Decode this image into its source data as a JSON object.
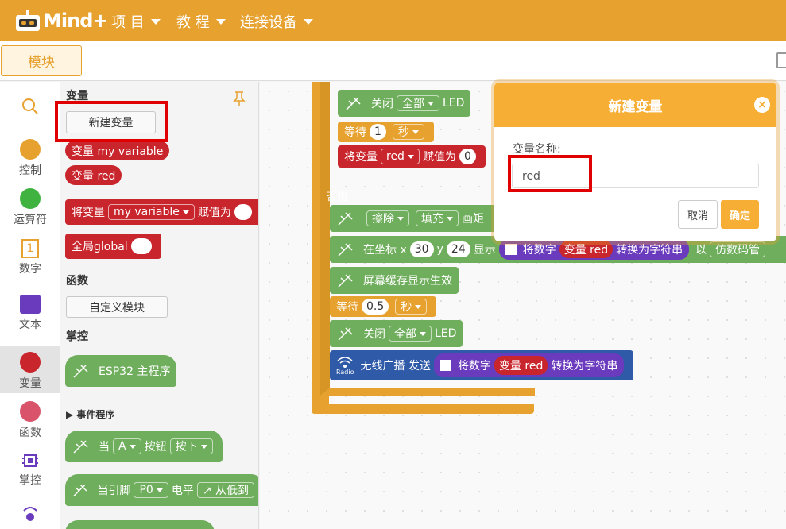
{
  "header": {
    "logo": "Mind+",
    "menus": [
      "项 目",
      "教 程",
      "连接设备"
    ]
  },
  "subbar": {
    "module_tab": "模块"
  },
  "categories": [
    {
      "label": "",
      "icon": "search-icon"
    },
    {
      "label": "控制",
      "color": "#e7a12f"
    },
    {
      "label": "运算符",
      "color": "#3fb23f"
    },
    {
      "label": "数字",
      "icon": "number-icon",
      "glyph": "1"
    },
    {
      "label": "文本",
      "icon": "text-icon"
    },
    {
      "label": "变量",
      "color": "#c8252c"
    },
    {
      "label": "函数",
      "color": "#d9536a"
    },
    {
      "label": "掌控",
      "icon": "chip-icon"
    },
    {
      "label": "",
      "icon": "radio-icon"
    }
  ],
  "flyout": {
    "section_variable": "变量",
    "new_variable_button": "新建变量",
    "var_my_variable": "变量 my variable",
    "var_red": "变量 red",
    "set_var_prefix": "将变量",
    "set_var_name": "my variable",
    "set_var_suffix": "赋值为",
    "global_label": "全局global",
    "section_function": "函数",
    "custom_block_button": "自定义模块",
    "section_controller": "掌控",
    "esp32_main": "ESP32 主程序",
    "event_section": "▶ 事件程序",
    "when_prefix": "当",
    "when_btn": "A",
    "when_key": "按钮",
    "when_press": "按下",
    "pin_prefix": "当引脚",
    "pin_name": "P0",
    "pin_level": "电平",
    "pin_edge": "↗ 从低到"
  },
  "workspace": {
    "off_label": "关闭",
    "all_label": "全部",
    "led_label": "LED",
    "wait_label": "等待",
    "wait_1": "1",
    "sec_label": "秒",
    "set_var_prefix": "将变量",
    "set_var_name": "red",
    "set_var_suffix": "赋值为",
    "set_var_val": "0",
    "else_label": "否则",
    "erase_label": "擦除",
    "fill_label": "填充",
    "draw_label": "画矩",
    "at_coord": "在坐标 x",
    "x_val": "30",
    "y_label": "y",
    "y_val": "24",
    "show_label": "显示",
    "num_to_str_prefix": "将数字",
    "var_red": "变量 red",
    "num_to_str_suffix": "转换为字符串",
    "with_label": "以",
    "font_label": "仿数码管",
    "buffer_show": "屏幕缓存显示生效",
    "wait_05": "0.5",
    "radio_label": "Radio",
    "radio_send": "无线广播 发送"
  },
  "dialog": {
    "title": "新建变量",
    "close": "×",
    "name_label": "变量名称:",
    "input_value": "red",
    "cancel": "取消",
    "ok": "确定"
  },
  "colors": {
    "accent": "#e7a12f",
    "dialog_header": "#f6ae34",
    "variable_block": "#c8252c",
    "controller_block": "#6fae5c",
    "text_block": "#6b3bbd",
    "highlight": "#e00000"
  }
}
